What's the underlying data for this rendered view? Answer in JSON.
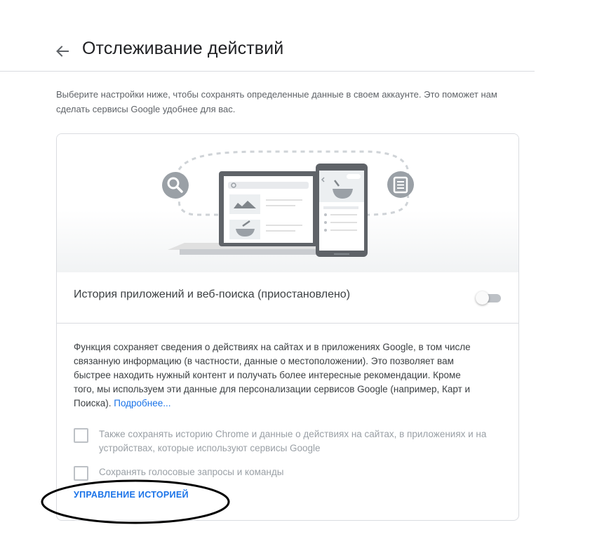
{
  "header": {
    "title": "Отслеживание действий",
    "back_icon": "arrow-back-icon"
  },
  "intro": {
    "text": "Выберите настройки ниже, чтобы сохранять определенные данные в своем аккаунте. Это поможет нам сделать сервисы Google удобнее для вас."
  },
  "card": {
    "setting": {
      "label": "История приложений и веб-поиска (приостановлено)",
      "enabled": false
    },
    "description": {
      "text": "Функция сохраняет сведения о действиях на сайтах и в приложениях Google, в том числе связанную информацию (в частности, данные о местоположении). Это позволяет вам быстрее находить нужный контент и получать более интересные рекомендации. Кроме того, мы используем эти данные для персонализации сервисов Google (например, Карт и Поиска).",
      "link": "Подробнее..."
    },
    "options": [
      {
        "label": "Также сохранять историю Chrome и данные о действиях на сайтах, в приложениях и на устройствах, которые используют сервисы Google",
        "checked": false
      },
      {
        "label": "Сохранять голосовые запросы и команды",
        "checked": false
      }
    ],
    "manage_link": "УПРАВЛЕНИЕ ИСТОРИЕЙ"
  },
  "colors": {
    "accent": "#1a73e8",
    "title_text": "#202124",
    "secondary_text": "#5f6368",
    "disabled_text": "#9aa0a6",
    "divider": "#dadce0",
    "annotation": "#000000"
  }
}
